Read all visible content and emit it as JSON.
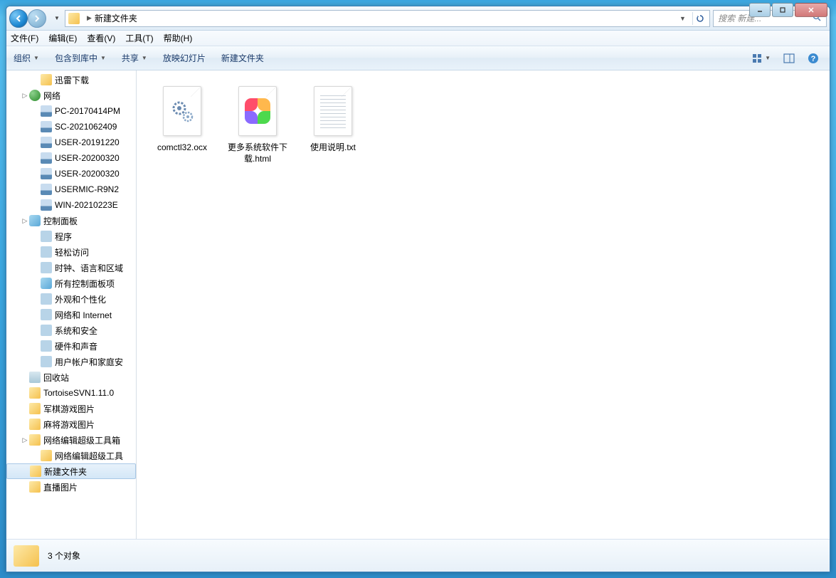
{
  "titlebar": {
    "min": "_",
    "max": "□",
    "close": "✕"
  },
  "nav": {
    "current_folder": "新建文件夹",
    "search_placeholder": "搜索 新建..."
  },
  "menubar": {
    "file": "文件(F)",
    "edit": "编辑(E)",
    "view": "查看(V)",
    "tools": "工具(T)",
    "help": "帮助(H)"
  },
  "toolbar": {
    "organize": "组织",
    "include": "包含到库中",
    "share": "共享",
    "slideshow": "放映幻灯片",
    "newfolder": "新建文件夹"
  },
  "sidebar": [
    {
      "indent": 2,
      "icon": "folder",
      "label": "迅雷下载",
      "name": "tree-xunlei"
    },
    {
      "indent": 1,
      "icon": "network",
      "label": "网络",
      "name": "tree-network",
      "expandable": true
    },
    {
      "indent": 2,
      "icon": "pc",
      "label": "PC-20170414PM",
      "name": "tree-pc1"
    },
    {
      "indent": 2,
      "icon": "pc",
      "label": "SC-2021062409",
      "name": "tree-pc2"
    },
    {
      "indent": 2,
      "icon": "pc",
      "label": "USER-20191220",
      "name": "tree-pc3"
    },
    {
      "indent": 2,
      "icon": "pc",
      "label": "USER-20200320",
      "name": "tree-pc4"
    },
    {
      "indent": 2,
      "icon": "pc",
      "label": "USER-20200320",
      "name": "tree-pc5"
    },
    {
      "indent": 2,
      "icon": "pc",
      "label": "USERMIC-R9N2",
      "name": "tree-pc6"
    },
    {
      "indent": 2,
      "icon": "pc",
      "label": "WIN-20210223E",
      "name": "tree-pc7"
    },
    {
      "indent": 1,
      "icon": "cpanel",
      "label": "控制面板",
      "name": "tree-cpanel",
      "expandable": true
    },
    {
      "indent": 2,
      "icon": "generic",
      "label": "程序",
      "name": "tree-programs"
    },
    {
      "indent": 2,
      "icon": "generic",
      "label": "轻松访问",
      "name": "tree-ease"
    },
    {
      "indent": 2,
      "icon": "generic",
      "label": "时钟、语言和区域",
      "name": "tree-region"
    },
    {
      "indent": 2,
      "icon": "cpanel",
      "label": "所有控制面板项",
      "name": "tree-allcp"
    },
    {
      "indent": 2,
      "icon": "generic",
      "label": "外观和个性化",
      "name": "tree-personal"
    },
    {
      "indent": 2,
      "icon": "generic",
      "label": "网络和 Internet",
      "name": "tree-netint"
    },
    {
      "indent": 2,
      "icon": "generic",
      "label": "系统和安全",
      "name": "tree-syssec"
    },
    {
      "indent": 2,
      "icon": "generic",
      "label": "硬件和声音",
      "name": "tree-hwsound"
    },
    {
      "indent": 2,
      "icon": "generic",
      "label": "用户帐户和家庭安",
      "name": "tree-useracc"
    },
    {
      "indent": 1,
      "icon": "recycle",
      "label": "回收站",
      "name": "tree-recycle"
    },
    {
      "indent": 1,
      "icon": "folder",
      "label": "TortoiseSVN1.11.0",
      "name": "tree-svn"
    },
    {
      "indent": 1,
      "icon": "folder",
      "label": "军棋游戏图片",
      "name": "tree-junqi"
    },
    {
      "indent": 1,
      "icon": "folder",
      "label": "麻将游戏图片",
      "name": "tree-mahjong"
    },
    {
      "indent": 1,
      "icon": "folder",
      "label": "网络编辑超级工具箱",
      "name": "tree-nettool",
      "expandable": true
    },
    {
      "indent": 2,
      "icon": "folder",
      "label": "网络编辑超级工具",
      "name": "tree-nettool2"
    },
    {
      "indent": 1,
      "icon": "folder",
      "label": "新建文件夹",
      "name": "tree-newfolder",
      "selected": true
    },
    {
      "indent": 1,
      "icon": "folder",
      "label": "直播图片",
      "name": "tree-live"
    }
  ],
  "files": [
    {
      "name": "comctl32.ocx",
      "type": "ocx"
    },
    {
      "name": "更多系统软件下载.html",
      "type": "html"
    },
    {
      "name": "使用说明.txt",
      "type": "txt"
    }
  ],
  "status": {
    "count": "3 个对象"
  }
}
